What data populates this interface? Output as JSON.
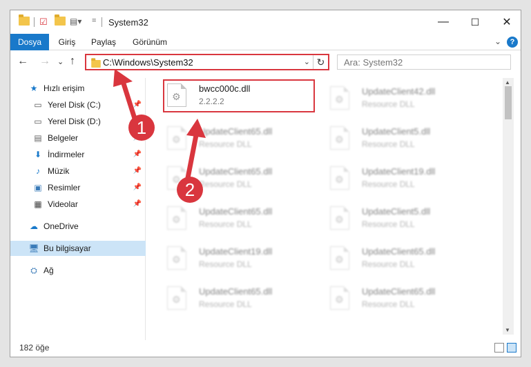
{
  "window": {
    "title": "System32",
    "controls": {
      "minimize": "—",
      "maximize": "☐",
      "close": "✕"
    }
  },
  "ribbon": {
    "tabs": [
      "Dosya",
      "Giriş",
      "Paylaş",
      "Görünüm"
    ],
    "active_tab": "Dosya",
    "help": "?",
    "expand": "⌄"
  },
  "nav": {
    "back": "←",
    "forward": "→",
    "recent": "⌄",
    "up": "↑",
    "address": "C:\\Windows\\System32",
    "address_dropdown": "⌄",
    "refresh": "↻",
    "search_placeholder": "Ara: System32"
  },
  "sidebar": {
    "items": [
      {
        "label": "Hızlı erişim",
        "icon": "star-icon",
        "pinned": false
      },
      {
        "label": "Yerel Disk (C:)",
        "icon": "drive-icon",
        "pinned": true
      },
      {
        "label": "Yerel Disk (D:)",
        "icon": "drive-icon",
        "pinned": true
      },
      {
        "label": "Belgeler",
        "icon": "document-icon",
        "pinned": true
      },
      {
        "label": "İndirmeler",
        "icon": "download-icon",
        "pinned": true
      },
      {
        "label": "Müzik",
        "icon": "music-icon",
        "pinned": true
      },
      {
        "label": "Resimler",
        "icon": "pictures-icon",
        "pinned": true
      },
      {
        "label": "Videolar",
        "icon": "video-icon",
        "pinned": true
      },
      {
        "label": "OneDrive",
        "icon": "cloud-icon",
        "pinned": false
      },
      {
        "label": "Bu bilgisayar",
        "icon": "computer-icon",
        "pinned": false,
        "selected": true
      },
      {
        "label": "Ağ",
        "icon": "network-icon",
        "pinned": false
      }
    ],
    "pin_glyph": "📌"
  },
  "files": {
    "highlighted": {
      "name": "bwcc000c.dll",
      "detail": "2.2.2.2"
    },
    "left_column": [
      {
        "name": "UpdateClient65.dll",
        "detail": "Resource DLL"
      },
      {
        "name": "UpdateClient65.dll",
        "detail": "Resource DLL"
      },
      {
        "name": "UpdateClient65.dll",
        "detail": "Resource DLL"
      },
      {
        "name": "UpdateClient19.dll",
        "detail": "Resource DLL"
      },
      {
        "name": "UpdateClient65.dll",
        "detail": "Resource DLL"
      }
    ],
    "right_column": [
      {
        "name": "UpdateClient42.dll",
        "detail": "Resource DLL"
      },
      {
        "name": "UpdateClient5.dll",
        "detail": "Resource DLL"
      },
      {
        "name": "UpdateClient19.dll",
        "detail": "Resource DLL"
      },
      {
        "name": "UpdateClient5.dll",
        "detail": "Resource DLL"
      },
      {
        "name": "UpdateClient65.dll",
        "detail": "Resource DLL"
      },
      {
        "name": "UpdateClient65.dll",
        "detail": "Resource DLL"
      }
    ]
  },
  "status": {
    "item_count": "182 öğe"
  },
  "callouts": {
    "one": "1",
    "two": "2"
  },
  "colors": {
    "accent": "#1979ca",
    "highlight": "#d9363e",
    "selected": "#cce4f7"
  }
}
